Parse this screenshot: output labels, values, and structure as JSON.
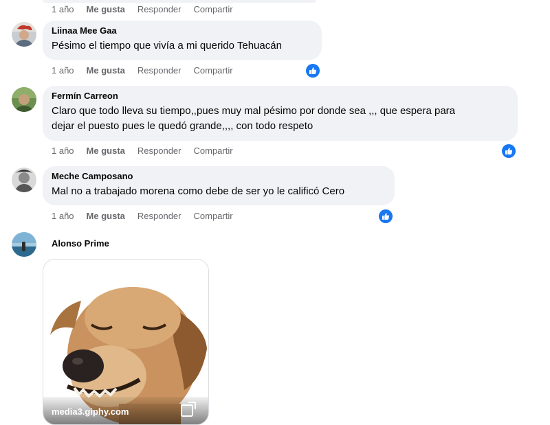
{
  "actions": {
    "time": "1 año",
    "like": "Me gusta",
    "reply": "Responder",
    "share": "Compartir"
  },
  "comments": [
    {
      "author": "Liinaa Mee Gaa",
      "text": "Pésimo el tiempo que vivía a mi querido Tehuacán",
      "reaction": "like-icon"
    },
    {
      "author": "Fermín Carreon",
      "text_lines": [
        "Claro que todo lleva su tiempo,,pues muy mal pésimo por donde sea ,,, que espera para",
        "dejar el puesto pues le quedó grande,,,, con todo respeto"
      ],
      "reaction": "like-icon"
    },
    {
      "author": "Meche Camposano",
      "text": "Mal no a trabajado morena como debe de ser yo le calificó Cero",
      "reaction": "like-icon"
    },
    {
      "author": "Alonso Prime",
      "attachment": {
        "type": "gif",
        "source": "media3.giphy.com"
      }
    }
  ],
  "colors": {
    "bubble": "#f0f2f5",
    "meta_text": "#65676b",
    "like_blue": "#1877f2"
  }
}
